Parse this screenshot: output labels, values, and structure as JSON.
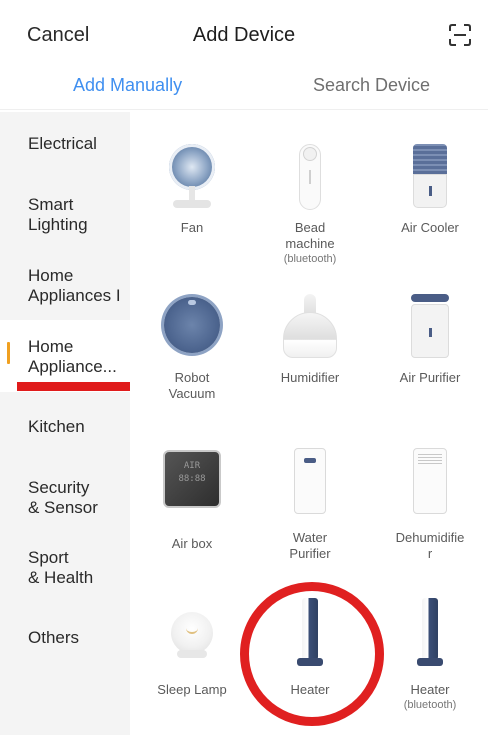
{
  "header": {
    "cancel_label": "Cancel",
    "title": "Add Device",
    "scan_icon": "scan-icon"
  },
  "tabs": [
    {
      "label": "Add Manually",
      "active": true
    },
    {
      "label": "Search Device",
      "active": false
    }
  ],
  "colors": {
    "accent": "#3f8ff0",
    "sidebar_bg": "#f4f4f4",
    "active_marker": "#f0a020",
    "annotation_red": "#e01b1b"
  },
  "sidebar": {
    "items": [
      {
        "label": "Electrical"
      },
      {
        "label": "Smart\nLighting"
      },
      {
        "label": "Home\nAppliances I"
      },
      {
        "label": "Home\nAppliance...",
        "active": true
      },
      {
        "label": "Kitchen"
      },
      {
        "label": "Security\n& Sensor"
      },
      {
        "label": "Sport\n& Health"
      },
      {
        "label": "Others"
      }
    ]
  },
  "devices": [
    {
      "label": "Fan",
      "icon": "fan-icon"
    },
    {
      "label": "Bead\nmachine",
      "sub": "(bluetooth)",
      "icon": "bead-machine-icon"
    },
    {
      "label": "Air Cooler",
      "icon": "air-cooler-icon"
    },
    {
      "label": "Robot\nVacuum",
      "icon": "robot-vacuum-icon"
    },
    {
      "label": "Humidifier",
      "icon": "humidifier-icon"
    },
    {
      "label": "Air Purifier",
      "icon": "air-purifier-icon"
    },
    {
      "label": "Air box",
      "icon": "air-box-icon",
      "screen_text": "AIR\n88:88"
    },
    {
      "label": "Water\nPurifier",
      "icon": "water-purifier-icon"
    },
    {
      "label": "Dehumidifie\nr",
      "icon": "dehumidifier-icon"
    },
    {
      "label": "Sleep Lamp",
      "icon": "sleep-lamp-icon"
    },
    {
      "label": "Heater",
      "icon": "heater-icon"
    },
    {
      "label": "Heater",
      "sub": "(bluetooth)",
      "icon": "heater-bluetooth-icon"
    }
  ]
}
